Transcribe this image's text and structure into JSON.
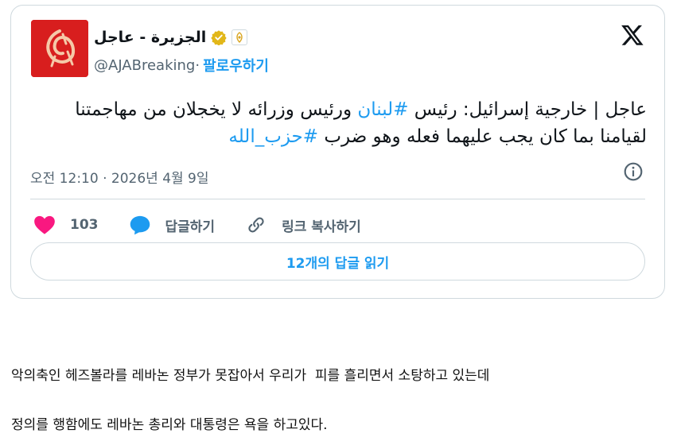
{
  "tweet": {
    "display_name": "الجزيرة - عاجل",
    "handle": "@AJABreaking",
    "separator": " · ",
    "follow_label": "팔로우하기",
    "text_line1_prefix": "عاجل | خارجية إسرائيل: رئيس ",
    "text_hashtag1": "#لبنان",
    "text_line1_suffix": " ورئيس وزرائه لا يخجلان من مهاجمتنا لقيامنا بما كان يجب عليهما فعله وهو ضرب ",
    "text_hashtag2": "#حزب_الله",
    "timestamp": "오전 12:10 · 2026년 4월 9일",
    "like_count": "103",
    "reply_label": "답글하기",
    "copy_link_label": "링크 복사하기",
    "read_replies_label": "12개의 답글 읽기"
  },
  "comments": {
    "line1": "악의축인 헤즈볼라를 레바논 정부가 못잡아서 우리가  피를 흘리면서 소탕하고 있는데",
    "line2": "정의를 행함에도 레바논 총리와 대통령은 욕을 하고있다."
  },
  "colors": {
    "accent": "#1d9bf0",
    "like": "#f91880",
    "avatar_bg": "#d81e1e",
    "verified": "#e2b719"
  },
  "icons": [
    "x-logo-icon",
    "verified-badge-icon",
    "affiliate-badge-icon",
    "info-icon",
    "heart-icon",
    "reply-icon",
    "link-icon"
  ]
}
